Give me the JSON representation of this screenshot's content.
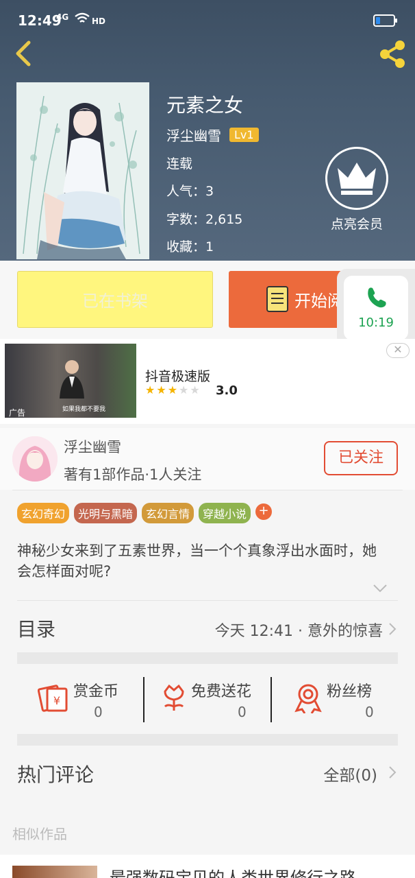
{
  "status_bar": {
    "time": "12:49",
    "network": "4G",
    "hd": "HD"
  },
  "book": {
    "title": "元素之女",
    "author": "浮尘幽雪",
    "level": "Lv1",
    "status": "连载",
    "popularity": "人气：3",
    "word_count": "字数：2,615",
    "favorites": "收藏：1"
  },
  "vip": {
    "label": "点亮会员"
  },
  "actions": {
    "shelf_label": "已在书架",
    "read_label": "开始阅读"
  },
  "call_popup": {
    "time": "10:19"
  },
  "ad": {
    "title": "抖音极速版",
    "rating": "3.0",
    "rating_stars": 3,
    "tag": "广告",
    "caption": "如果我都不要我"
  },
  "author_card": {
    "name": "浮尘幽雪",
    "stats": "著有1部作品·1人关注",
    "follow_label": "已关注"
  },
  "tags": [
    {
      "label": "玄幻奇幻",
      "color": "#f0a22e"
    },
    {
      "label": "光明与黑暗",
      "color": "#c4674f"
    },
    {
      "label": "玄幻言情",
      "color": "#d29a3a"
    },
    {
      "label": "穿越小说",
      "color": "#8fb34f"
    }
  ],
  "synopsis": "神秘少女来到了五素世界，当一个个真象浮出水面时，她会怎样面对呢?",
  "toc": {
    "label": "目录",
    "latest": "今天 12:41 · 意外的惊喜"
  },
  "rewards": [
    {
      "label": "赏金币",
      "count": "0",
      "icon": "gold-coin-icon"
    },
    {
      "label": "免费送花",
      "count": "0",
      "icon": "flower-icon"
    },
    {
      "label": "粉丝榜",
      "count": "0",
      "icon": "fan-medal-icon"
    }
  ],
  "comments": {
    "label": "热门评论",
    "all_label": "全部(0)"
  },
  "similar": {
    "label": "相似作品",
    "first_title": "最强数码宝贝的人类世界修行之路"
  },
  "colors": {
    "accent_orange": "#ec6a3c",
    "shelf_yellow": "#fff67e",
    "follow_red": "#e24c33",
    "call_green": "#1da352"
  }
}
